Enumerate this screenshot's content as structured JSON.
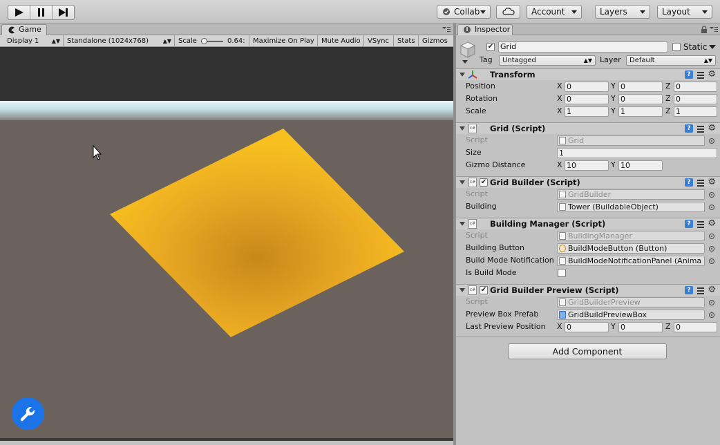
{
  "toolbar": {
    "play_icon": "play-icon",
    "pause_icon": "pause-icon",
    "step_icon": "step-icon",
    "collab_label": "Collab",
    "cloud_icon": "cloud-icon",
    "account_label": "Account",
    "layers_label": "Layers",
    "layout_label": "Layout"
  },
  "game": {
    "tab_label": "Game",
    "options": {
      "display": "Display 1",
      "resolution": "Standalone (1024x768)",
      "scale_label": "Scale",
      "scale_value": "0.64:",
      "maximize_on_play": "Maximize On Play",
      "mute_audio": "Mute Audio",
      "vsync": "VSync",
      "stats": "Stats",
      "gizmos": "Gizmos"
    },
    "scene": {
      "sky_color": "#323232",
      "horizon_color": "#c3e1e6",
      "ground_color": "#6c625d",
      "plane_color": "#f5b724"
    }
  },
  "inspector": {
    "tab_label": "Inspector",
    "object": {
      "active": true,
      "name": "Grid",
      "static_label": "Static",
      "tag_label": "Tag",
      "tag_value": "Untagged",
      "layer_label": "Layer",
      "layer_value": "Default"
    },
    "transform": {
      "title": "Transform",
      "rows": [
        {
          "label": "Position",
          "x": "0",
          "y": "0",
          "z": "0"
        },
        {
          "label": "Rotation",
          "x": "0",
          "y": "0",
          "z": "0"
        },
        {
          "label": "Scale",
          "x": "1",
          "y": "1",
          "z": "1"
        }
      ]
    },
    "grid_script": {
      "title": "Grid (Script)",
      "script_label": "Script",
      "script_value": "Grid",
      "size_label": "Size",
      "size_value": "1",
      "gizmo_label": "Gizmo Distance",
      "gizmo_x": "10",
      "gizmo_y": "10"
    },
    "grid_builder": {
      "title": "Grid Builder (Script)",
      "enabled": true,
      "script_label": "Script",
      "script_value": "GridBuilder",
      "building_label": "Building",
      "building_value": "Tower (BuildableObject)"
    },
    "building_manager": {
      "title": "Building Manager (Script)",
      "script_label": "Script",
      "script_value": "BuildingManager",
      "button_label": "Building Button",
      "button_value": "BuildModeButton (Button)",
      "notification_label": "Build Mode Notification",
      "notification_value": "BuildModeNotificationPanel (Anima",
      "is_build_mode_label": "Is Build Mode",
      "is_build_mode": false
    },
    "grid_builder_preview": {
      "title": "Grid Builder Preview (Script)",
      "enabled": true,
      "script_label": "Script",
      "script_value": "GridBuilderPreview",
      "prefab_label": "Preview Box Prefab",
      "prefab_value": "GridBuildPreviewBox",
      "last_pos_label": "Last Preview Position",
      "x": "0",
      "y": "0",
      "z": "0"
    },
    "add_component": "Add Component"
  },
  "axes": {
    "x": "X",
    "y": "Y",
    "z": "Z"
  },
  "colors": {
    "accent": "#1a74e8",
    "help_icon": "#3b7fd3",
    "panel": "#c2c2c2"
  }
}
